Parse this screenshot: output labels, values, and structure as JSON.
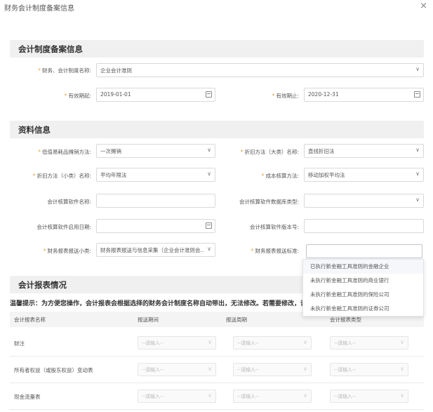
{
  "window": {
    "title": "财务会计制度备案信息",
    "close_glyph": "×"
  },
  "sections": {
    "s1": "会计制度备案信息",
    "s2": "资料信息",
    "s3": "会计报表情况"
  },
  "form1": {
    "system_name": {
      "label": "财务、会计制度名称",
      "value": "企业会计准则"
    },
    "valid_from": {
      "label": "有效期起",
      "value": "2019-01-01"
    },
    "valid_to": {
      "label": "有效期止",
      "value": "2020-12-31"
    }
  },
  "form2": {
    "low_value": {
      "label": "低值易耗品摊销方法",
      "value": "一次摊销"
    },
    "dep_major": {
      "label": "折旧方法（大类）名称",
      "value": "直线折旧法"
    },
    "dep_minor": {
      "label": "折旧方法（小类）名称",
      "value": "平均年限法"
    },
    "cost_method": {
      "label": "成本核算方法",
      "value": "移动加权平均法"
    },
    "sw_name": {
      "label": "会计核算软件名称",
      "value": ""
    },
    "sw_db": {
      "label": "会计核算软件数据库类型",
      "value": ""
    },
    "sw_date": {
      "label": "会计核算软件启用日期",
      "value": ""
    },
    "sw_version": {
      "label": "会计核算软件版本号",
      "value": ""
    },
    "report_minor": {
      "label": "财务报表报送小类",
      "value": "财务报表报送与信息采集（企业会计准则会..."
    },
    "report_std": {
      "label": "财务报表报送标准",
      "value": ""
    }
  },
  "dropdown_options": [
    "已执行新金融工具准则的金融企业",
    "未执行新金融工具准则的商业银行",
    "未执行新金融工具准则的保险公司",
    "未执行新金融工具准则的证券公司"
  ],
  "tip": "温馨提示：为方便您操作，会计报表会根据选择的财务会计制度名称自动带出，无法修改。若需要修改，请",
  "table": {
    "headers": [
      "会计报表名称",
      "报送期间",
      "报送周期",
      "会计报表类型"
    ],
    "placeholder": "--请输入--",
    "rows": [
      "财注",
      "所有者权益（或股东权益）变动表",
      "现金流量表"
    ]
  }
}
